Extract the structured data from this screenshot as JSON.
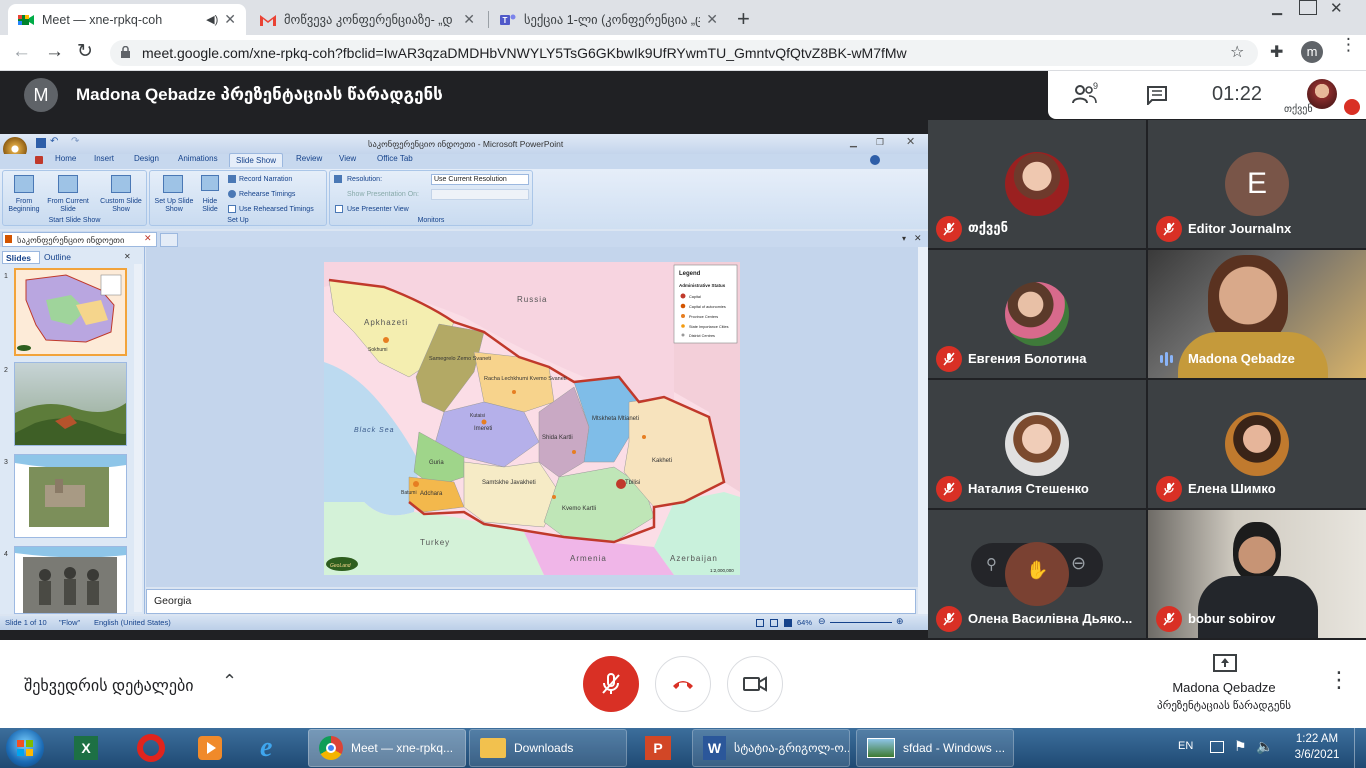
{
  "browser": {
    "tabs": [
      {
        "title": "Meet — xne-rpkq-coh",
        "active": true
      },
      {
        "title": "მოწვევა კონფერენციაზე- „დ",
        "active": false
      },
      {
        "title": "სექცია 1-ლი (კონფერენცია „ც",
        "active": false
      }
    ],
    "url": "meet.google.com/xne-rpkq-coh?fbclid=IwAR3qzaDMDHbVNWYLY5TsG6GKbwIk9UfRYwmTU_GmntvQfQtvZ8BK-wM7fMw",
    "profile_initial": "m"
  },
  "meet": {
    "presenter_initial": "M",
    "presenter_banner": "Madona Qebadze პრეზენტაციას წარადგენს",
    "people_count": "9",
    "clock": "01:22",
    "self_label": "თქვენ",
    "participants": [
      {
        "name": "თქვენ",
        "initial": "",
        "muted": true
      },
      {
        "name": "Editor Journalnx",
        "initial": "E",
        "muted": true
      },
      {
        "name": "Евгения Болотина",
        "initial": "",
        "muted": true
      },
      {
        "name": "Madona Qebadze",
        "initial": "",
        "muted": false
      },
      {
        "name": "Наталия Стешенко",
        "initial": "",
        "muted": true
      },
      {
        "name": "Елена Шимко",
        "initial": "",
        "muted": true
      },
      {
        "name": "Олена Василівна Дьяко...",
        "initial": "",
        "muted": true
      },
      {
        "name": "bobur sobirov",
        "initial": "",
        "muted": true
      }
    ],
    "meeting_details": "შეხვედრის დეტალები",
    "presenting_name": "Madona Qebadze",
    "presenting_sub": "პრეზენტაციას წარადგენს"
  },
  "ppt": {
    "title": "საკონფერენციო ინდოეთი - Microsoft PowerPoint",
    "tabs": [
      "Home",
      "Insert",
      "Design",
      "Animations",
      "Slide Show",
      "Review",
      "View",
      "Office Tab"
    ],
    "active_tab": "Slide Show",
    "buttons": {
      "from_beginning": "From Beginning",
      "from_current": "From Current Slide",
      "custom_show": "Custom Slide Show",
      "setup": "Set Up Slide Show",
      "hide": "Hide Slide",
      "record": "Record Narration",
      "rehearse": "Rehearse Timings",
      "use_rehearsed": "Use Rehearsed Timings",
      "resolution": "Resolution:",
      "resolution_value": "Use Current Resolution",
      "show_on": "Show Presentation On:",
      "presenter_view": "Use Presenter View"
    },
    "groups": {
      "start": "Start Slide Show",
      "setup": "Set Up",
      "monitors": "Monitors"
    },
    "doc_tab": "საკონფერენციო ინდოეთი",
    "panel_tabs": [
      "Slides",
      "Outline"
    ],
    "thumb_numbers": [
      "1",
      "2",
      "3",
      "4"
    ],
    "notes": "Georgia",
    "status": {
      "slide": "Slide 1 of 10",
      "theme": "\"Flow\"",
      "lang": "English (United States)",
      "zoom": "64%"
    }
  },
  "map": {
    "legend_title": "Legend",
    "legend_sub": "Administrative Status",
    "legend_items": [
      "Capital",
      "Capital of autonomies",
      "Province Centers",
      "State Importance Cities",
      "District Centres"
    ],
    "labels": {
      "russia": "Russia",
      "apkhazeti": "Apkhazeti",
      "black_sea": "Black Sea",
      "turkey": "Turkey",
      "armenia": "Armenia",
      "azerbaijan": "Azerbaijan",
      "guria": "Guria",
      "adchara": "Adchara",
      "samtskhe": "Samtskhe Javakheti",
      "kvemo": "Kvemo Kartli",
      "shida": "Shida Kartli",
      "kakheti": "Kakheti",
      "mtskheta": "Mtskheta Mtianeti",
      "racha": "Racha Lechkhumi Kvemo Svaneti",
      "imereti": "Imereti",
      "samegrelo": "Samegrelo Zemo Svaneti",
      "tbilisi": "Tbilisi",
      "sokhumi": "Sokhumi",
      "batumi": "Batumi",
      "kutaisi": "Kutaisi"
    },
    "scale": "1:2,000,000",
    "logo": "GeoLand"
  },
  "taskbar": {
    "items": [
      "Meet — xne-rpkq...",
      "Downloads",
      "სტატია-გრიგოლ-ო...",
      "sfdad - Windows ..."
    ],
    "lang": "EN",
    "time": "1:22 AM",
    "date": "3/6/2021"
  }
}
